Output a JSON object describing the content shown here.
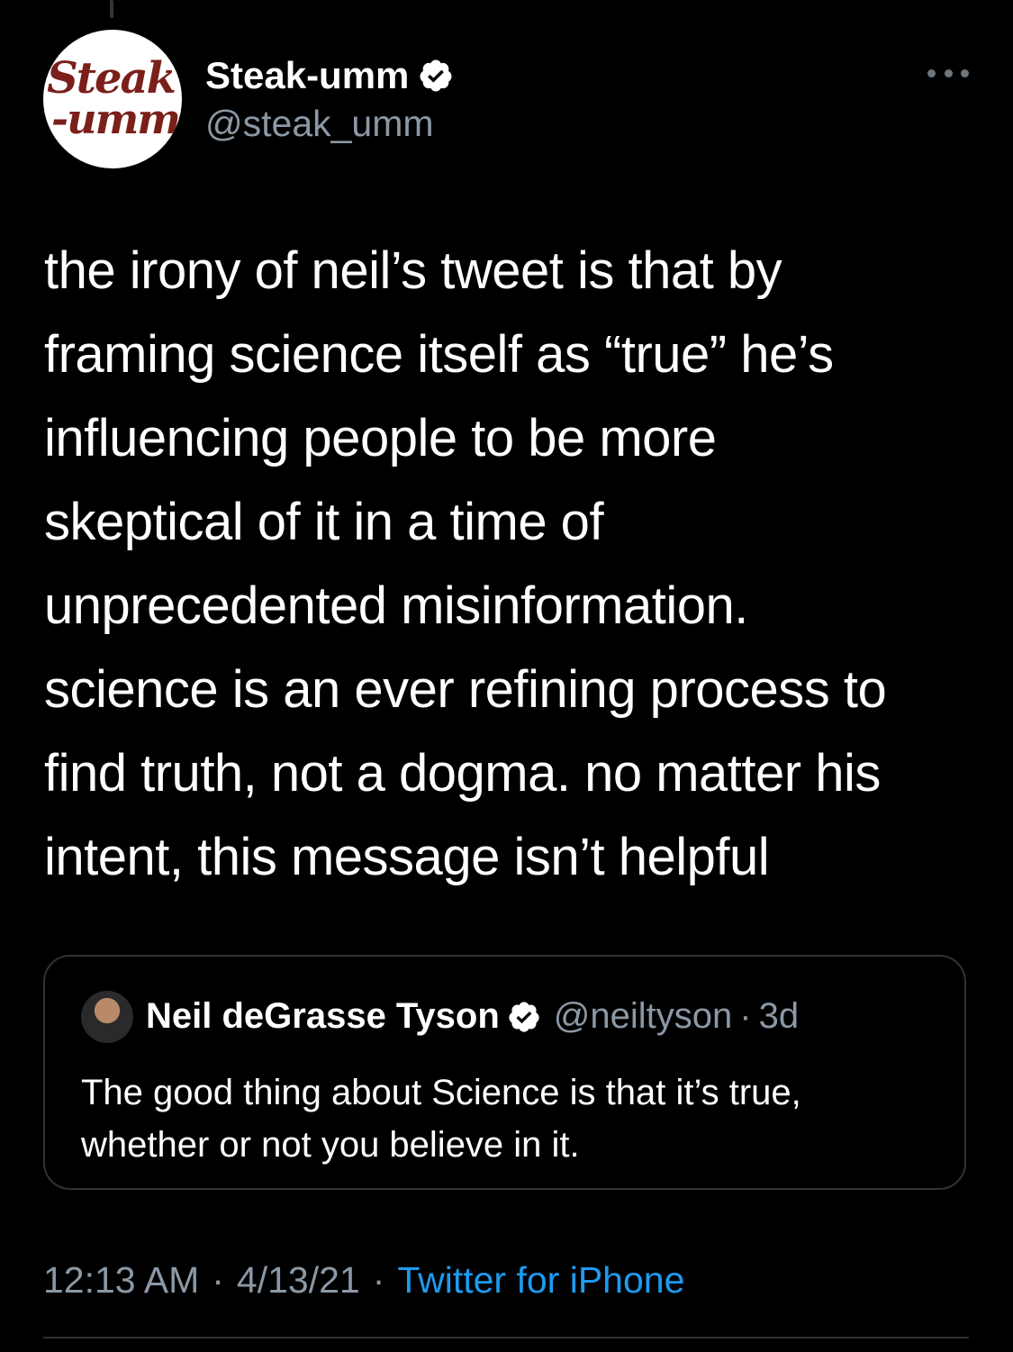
{
  "author": {
    "display_name": "Steak-umm",
    "handle": "@steak_umm",
    "avatar_logo_line1": "Steak",
    "avatar_logo_line2": "-umm",
    "verified": true
  },
  "tweet": {
    "lines": [
      "the irony of neil’s tweet is that by",
      "framing science itself as “true” he’s",
      "influencing people to be more",
      "skeptical of it in a time of",
      "unprecedented misinformation.",
      "science is an ever refining process to",
      "find truth, not a dogma. no matter his",
      "intent, this message isn’t helpful"
    ]
  },
  "quoted_tweet": {
    "display_name": "Neil deGrasse Tyson",
    "handle": "@neiltyson",
    "separator": "·",
    "relative_time": "3d",
    "verified": true,
    "lines": [
      "The good thing about Science is that it’s true,",
      "whether or not you believe in it."
    ]
  },
  "meta": {
    "time": "12:13 AM",
    "separator": "·",
    "date": "4/13/21",
    "source": "Twitter for iPhone"
  },
  "icons": {
    "verified": "verified-badge-icon",
    "more": "more-options-icon"
  },
  "colors": {
    "background": "#000000",
    "text": "#ffffff",
    "secondary": "#8b98a5",
    "link": "#1d9bf0",
    "border": "#2f3336",
    "logo": "#7a1f1a"
  }
}
